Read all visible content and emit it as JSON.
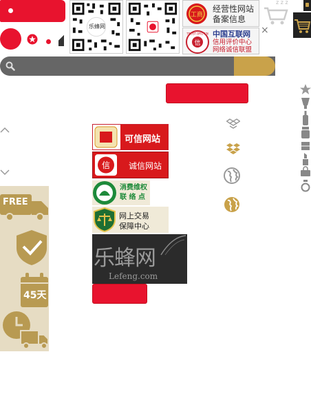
{
  "qr": {
    "caption": "乐蜂网"
  },
  "badges": {
    "record": {
      "line1": "经营性网站",
      "line2": "备案信息",
      "seal": "工商"
    },
    "trust": {
      "line1": "中国互联网",
      "line2": "信用评价中心",
      "line3": "网络诚信联盟",
      "seal": "信",
      "ring": "TRUST.ORG.CN"
    },
    "kexin": {
      "label": "可信网站"
    },
    "chengxin": {
      "label": "诚信网站",
      "seal": "信"
    },
    "consumer": {
      "line1": "消费维权",
      "line2": "联 络 点"
    },
    "trade": {
      "line1": "网上交易",
      "line2": "保障中心"
    }
  },
  "lefeng": {
    "name": "乐蜂网",
    "domain": "Lefeng.com"
  },
  "close": {
    "glyph": "×"
  },
  "sleep": {
    "glyph": "z z z"
  },
  "services": {
    "free": "FREE",
    "days": "45天"
  },
  "colors": {
    "brand": "#e8132e",
    "gold": "#c9a24a",
    "dark": "#222222",
    "search_bg": "#666666",
    "panel": "#e6dcc3"
  }
}
